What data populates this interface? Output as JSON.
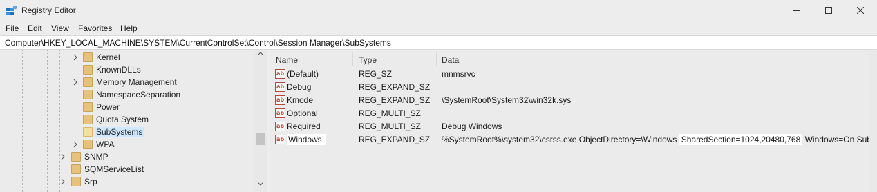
{
  "window": {
    "title": "Registry Editor",
    "icon": "registry-editor-icon",
    "controls": [
      "minimize-icon",
      "maximize-icon",
      "close-icon"
    ]
  },
  "menu": {
    "file": "File",
    "edit": "Edit",
    "view": "View",
    "favorites": "Favorites",
    "help": "Help"
  },
  "address": {
    "path": "Computer\\HKEY_LOCAL_MACHINE\\SYSTEM\\CurrentControlSet\\Control\\Session Manager\\SubSystems"
  },
  "tree": {
    "items": [
      {
        "label": "Kernel",
        "expandable": true,
        "selected": false
      },
      {
        "label": "KnownDLLs",
        "expandable": false,
        "selected": false
      },
      {
        "label": "Memory Management",
        "expandable": true,
        "selected": false
      },
      {
        "label": "NamespaceSeparation",
        "expandable": false,
        "selected": false
      },
      {
        "label": "Power",
        "expandable": false,
        "selected": false
      },
      {
        "label": "Quota System",
        "expandable": false,
        "selected": false
      },
      {
        "label": "SubSystems",
        "expandable": false,
        "selected": true
      },
      {
        "label": "WPA",
        "expandable": true,
        "selected": false
      },
      {
        "label": "SNMP",
        "expandable": true,
        "selected": false
      },
      {
        "label": "SQMServiceList",
        "expandable": false,
        "selected": false
      },
      {
        "label": "Srp",
        "expandable": true,
        "selected": false
      }
    ]
  },
  "values": {
    "columns": {
      "name": "Name",
      "type": "Type",
      "data": "Data"
    },
    "rows": [
      {
        "name": "(Default)",
        "type": "REG_SZ",
        "data": "mnmsrvc"
      },
      {
        "name": "Debug",
        "type": "REG_EXPAND_SZ",
        "data": ""
      },
      {
        "name": "Kmode",
        "type": "REG_EXPAND_SZ",
        "data": "\\SystemRoot\\System32\\win32k.sys"
      },
      {
        "name": "Optional",
        "type": "REG_MULTI_SZ",
        "data": ""
      },
      {
        "name": "Required",
        "type": "REG_MULTI_SZ",
        "data": "Debug Windows"
      },
      {
        "name": "Windows",
        "type": "REG_EXPAND_SZ",
        "data_before": "%SystemRoot%\\system32\\csrss.exe ObjectDirectory=\\Windows ",
        "data_highlight": "SharedSection=1024,20480,768",
        "data_after": " Windows=On SubS..."
      }
    ]
  },
  "colors": {
    "selection": "#cde8ff",
    "folder": "#e6c27a",
    "value_icon": "#c0392b"
  }
}
